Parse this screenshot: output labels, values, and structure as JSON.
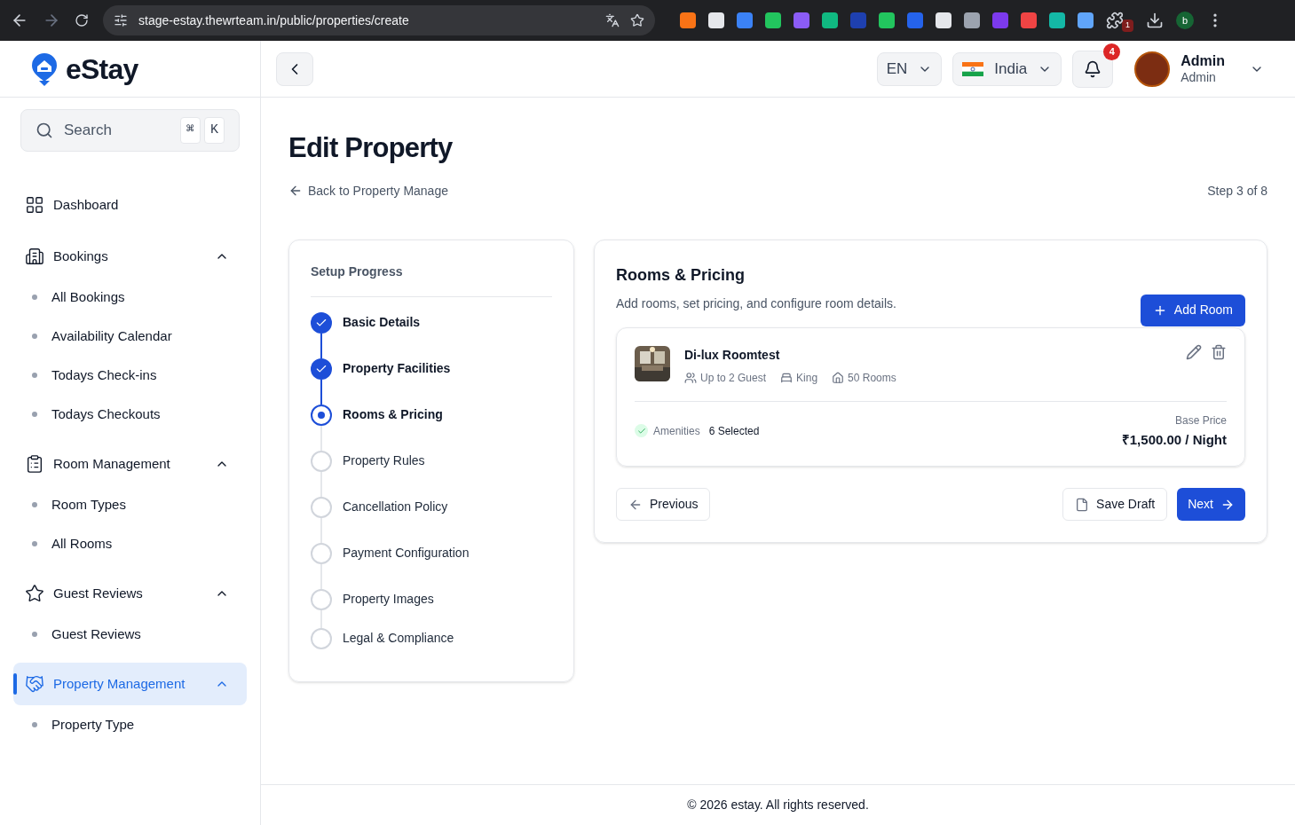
{
  "browser": {
    "url": "stage-estay.thewrteam.in/public/properties/create",
    "extension_badge": "1",
    "profile_initial": "b"
  },
  "sidebar": {
    "brand": "eStay",
    "search": {
      "placeholder": "Search",
      "keys": [
        "⌘",
        "K"
      ]
    },
    "items": [
      {
        "label": "Dashboard",
        "selected": false
      },
      {
        "label": "Bookings",
        "selected": false,
        "expanded": true,
        "children": [
          {
            "label": "All Bookings"
          },
          {
            "label": "Availability Calendar"
          },
          {
            "label": "Todays Check-ins"
          },
          {
            "label": "Todays Checkouts"
          }
        ]
      },
      {
        "label": "Room Management",
        "selected": false,
        "expanded": true,
        "children": [
          {
            "label": "Room Types"
          },
          {
            "label": "All Rooms"
          }
        ]
      },
      {
        "label": "Guest Reviews",
        "selected": false,
        "expanded": true,
        "children": [
          {
            "label": "Guest Reviews"
          }
        ]
      },
      {
        "label": "Property Management",
        "selected": true,
        "expanded": true,
        "children": [
          {
            "label": "Property Type"
          }
        ]
      }
    ]
  },
  "header": {
    "language": "EN",
    "country": "India",
    "notification_count": "4",
    "user": {
      "name": "Admin",
      "role": "Admin"
    }
  },
  "page": {
    "title": "Edit Property",
    "back_link": "Back to Property Manage",
    "step": "Step 3 of 8"
  },
  "progress": {
    "title": "Setup Progress",
    "steps": [
      {
        "label": "Basic Details",
        "completed": true,
        "selected": false
      },
      {
        "label": "Property Facilities",
        "completed": true,
        "selected": false
      },
      {
        "label": "Rooms & Pricing",
        "completed": false,
        "selected": true
      },
      {
        "label": "Property Rules",
        "completed": false,
        "selected": false
      },
      {
        "label": "Cancellation Policy",
        "completed": false,
        "selected": false
      },
      {
        "label": "Payment Configuration",
        "completed": false,
        "selected": false
      },
      {
        "label": "Property Images",
        "completed": false,
        "selected": false
      },
      {
        "label": "Legal & Compliance",
        "completed": false,
        "selected": false
      }
    ]
  },
  "rooms": {
    "title": "Rooms & Pricing",
    "subtitle": "Add rooms, set pricing, and configure room details.",
    "add_button": "Add Room",
    "items": [
      {
        "name": "Di-lux Roomtest",
        "guests": "Up to 2 Guest",
        "bed": "King",
        "count": "50 Rooms",
        "amenities_label": "Amenities",
        "amenities_value": "6 Selected",
        "price_label": "Base Price",
        "price": "₹1,500.00 / Night"
      }
    ],
    "previous": "Previous",
    "save_draft": "Save Draft",
    "next": "Next"
  },
  "footer": "© 2026 estay. All rights reserved."
}
